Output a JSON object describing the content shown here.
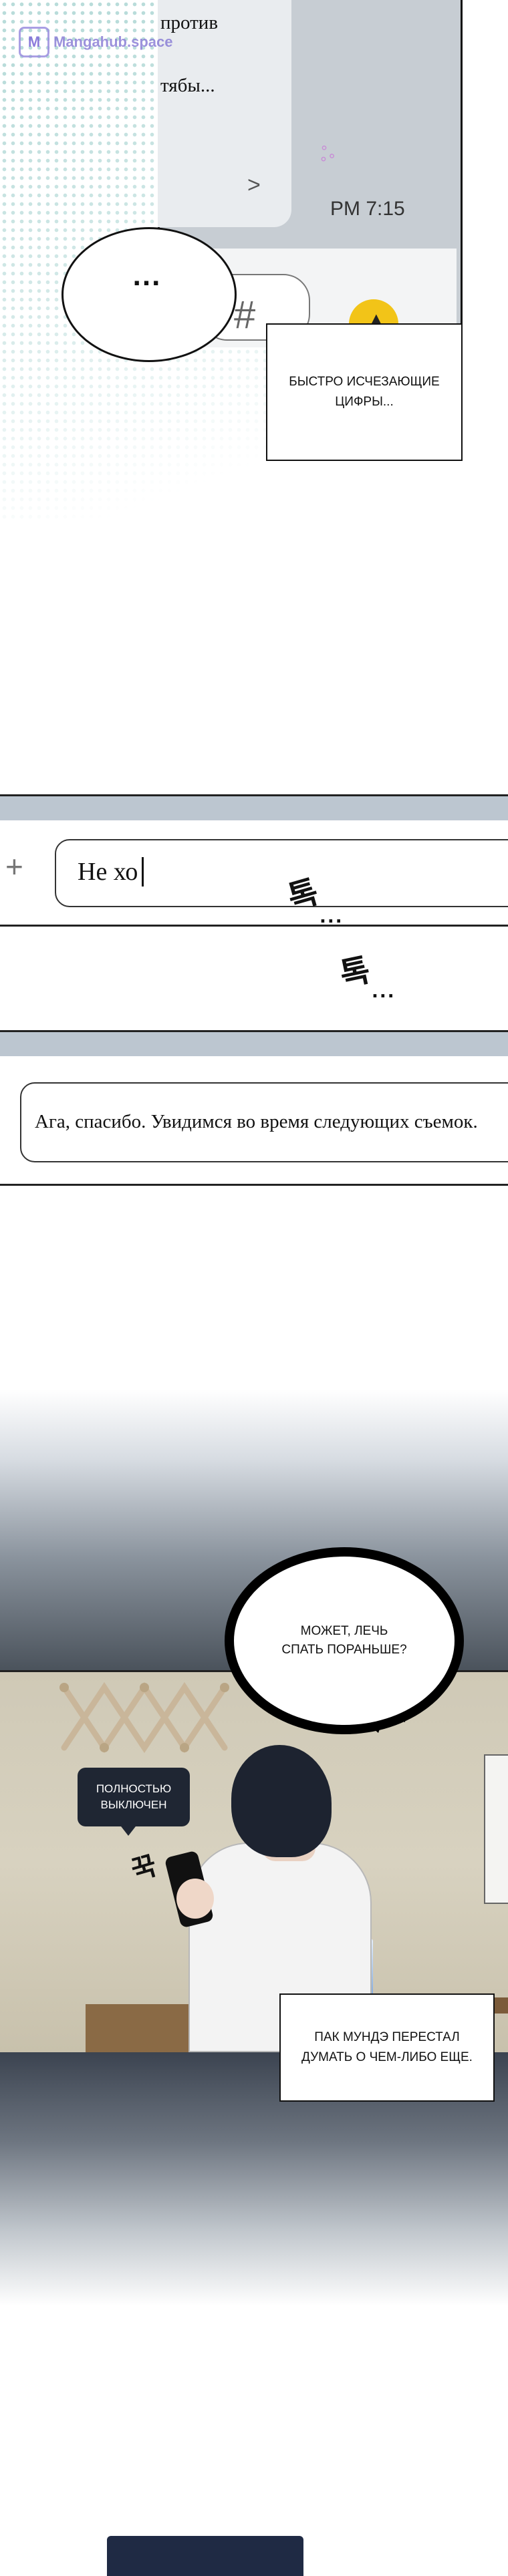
{
  "watermark": {
    "logo_text": "M",
    "text": "Mangahub.space"
  },
  "chat": {
    "message_lines": [
      "против",
      "тябы..."
    ],
    "time": "PM 7:15",
    "input_glyph": "#",
    "speech_text": "...",
    "caption": "БЫСТРО ИСЧЕЗАЮЩИЕ ЦИФРЫ..."
  },
  "typing": {
    "plus": "+",
    "input_text": "Не хо",
    "sfx": [
      "톡",
      "톡"
    ],
    "sfx_dots": "..."
  },
  "reply": {
    "text": "Ага, спасибо. Увидимся во время следующих съемок."
  },
  "room": {
    "thought": "МОЖЕТ, ЛЕЧЬ СПАТЬ ПОРАНЬШЕ?",
    "phone_tag": "ПОЛНОСТЬЮ ВЫКЛЮЧЕН",
    "sfx": "꾹",
    "caption": "ПАК МУНДЭ ПЕРЕСТАЛ ДУМАТЬ О ЧЕМ-ЛИБО ЕЩЕ."
  },
  "colors": {
    "accent_yellow": "#f2c418",
    "chat_strip": "#bcc6d0",
    "tag_bg": "#1f2633"
  }
}
